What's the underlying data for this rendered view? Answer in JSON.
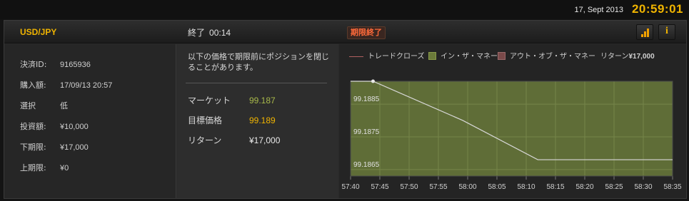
{
  "topbar": {
    "date": "17, Sept 2013",
    "time": "20:59:01"
  },
  "header": {
    "pair": "USD/JPY",
    "expiry_label": "終了",
    "expiry_time": "00:14",
    "status_badge": "期限終了"
  },
  "trade": {
    "rows": [
      {
        "label": "決済ID:",
        "value": "9165936"
      },
      {
        "label": "購入額:",
        "value": "17/09/13 20:57"
      },
      {
        "label": "選択",
        "value": "低"
      },
      {
        "label": "投資額:",
        "value": "¥10,000"
      },
      {
        "label": "下期限:",
        "value": "¥17,000"
      },
      {
        "label": "上期限:",
        "value": "¥0"
      }
    ]
  },
  "middle": {
    "notice": "以下の価格で期限前にポジションを閉じることがあります。",
    "rows": [
      {
        "label": "マーケット",
        "value": "99.187",
        "color": "#a8b84a"
      },
      {
        "label": "目標価格",
        "value": "99.189",
        "color": "#f0b400"
      },
      {
        "label": "リターン",
        "value": "¥17,000",
        "color": "#e8e8e8"
      }
    ]
  },
  "chart_legend": {
    "trade_close": "トレードクローズ",
    "in_the_money": "イン・ザ・マネー",
    "out_of_money": "アウト・オブ・ザ・マネー",
    "return_label": "リターン",
    "return_value": "¥17,000",
    "colors": {
      "trade_close": "#b06060",
      "in_the_money": "#6b7a3a",
      "out_of_money": "#7a4a4a"
    }
  },
  "chart_data": {
    "type": "line",
    "title": "",
    "xlabel": "",
    "ylabel": "",
    "x_ticks": [
      "57:40",
      "57:45",
      "57:50",
      "57:55",
      "58:00",
      "58:05",
      "58:10",
      "58:15",
      "58:20",
      "58:25",
      "58:30",
      "58:35"
    ],
    "y_ticks": [
      "99.1885",
      "99.1875",
      "99.1865"
    ],
    "ylim": [
      99.1863,
      99.1892
    ],
    "xlim_seconds": [
      57,
      100
    ],
    "series": [
      {
        "points": [
          {
            "t": 57,
            "price": 99.1892
          },
          {
            "t": 60,
            "price": 99.1892
          },
          {
            "t": 72,
            "price": 99.188
          },
          {
            "t": 82,
            "price": 99.1868
          },
          {
            "t": 100,
            "price": 99.1868
          }
        ],
        "color": "#d8d8d8"
      }
    ],
    "region": "in-the-money",
    "fill_color": "#5f6d37"
  }
}
